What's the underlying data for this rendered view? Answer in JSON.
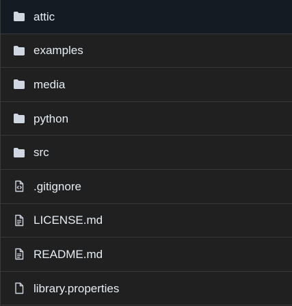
{
  "files": {
    "items": [
      {
        "name": "attic",
        "type": "folder",
        "icon": "folder-icon"
      },
      {
        "name": "examples",
        "type": "folder",
        "icon": "folder-icon"
      },
      {
        "name": "media",
        "type": "folder",
        "icon": "folder-icon"
      },
      {
        "name": "python",
        "type": "folder",
        "icon": "folder-icon"
      },
      {
        "name": "src",
        "type": "folder",
        "icon": "folder-icon"
      },
      {
        "name": ".gitignore",
        "type": "code-file",
        "icon": "code-file-icon"
      },
      {
        "name": "LICENSE.md",
        "type": "text-file",
        "icon": "text-file-icon"
      },
      {
        "name": "README.md",
        "type": "text-file",
        "icon": "text-file-icon"
      },
      {
        "name": "library.properties",
        "type": "file",
        "icon": "file-icon"
      }
    ]
  },
  "colors": {
    "background": "#202020",
    "highlighted_row": "#151b23",
    "divider": "#3a3a3a",
    "text": "#e6edf3",
    "icon": "#d1d7e0"
  }
}
